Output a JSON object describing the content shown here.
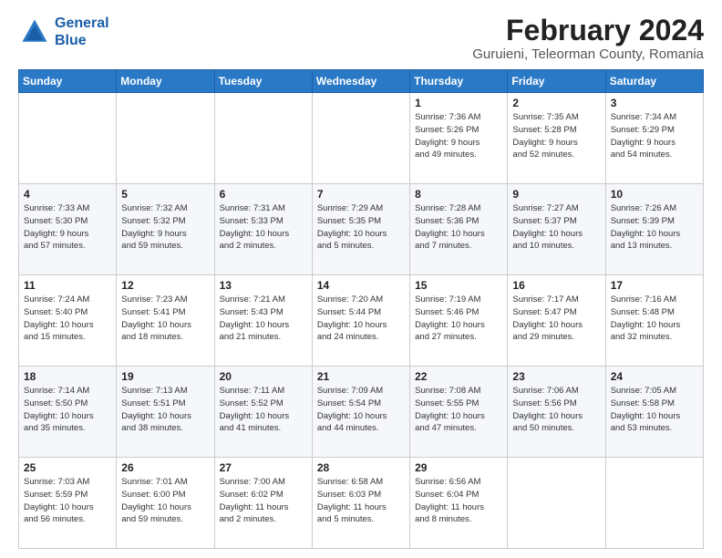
{
  "header": {
    "logo_line1": "General",
    "logo_line2": "Blue",
    "title": "February 2024",
    "subtitle": "Guruieni, Teleorman County, Romania"
  },
  "days_of_week": [
    "Sunday",
    "Monday",
    "Tuesday",
    "Wednesday",
    "Thursday",
    "Friday",
    "Saturday"
  ],
  "weeks": [
    [
      {
        "day": "",
        "info": ""
      },
      {
        "day": "",
        "info": ""
      },
      {
        "day": "",
        "info": ""
      },
      {
        "day": "",
        "info": ""
      },
      {
        "day": "1",
        "info": "Sunrise: 7:36 AM\nSunset: 5:26 PM\nDaylight: 9 hours\nand 49 minutes."
      },
      {
        "day": "2",
        "info": "Sunrise: 7:35 AM\nSunset: 5:28 PM\nDaylight: 9 hours\nand 52 minutes."
      },
      {
        "day": "3",
        "info": "Sunrise: 7:34 AM\nSunset: 5:29 PM\nDaylight: 9 hours\nand 54 minutes."
      }
    ],
    [
      {
        "day": "4",
        "info": "Sunrise: 7:33 AM\nSunset: 5:30 PM\nDaylight: 9 hours\nand 57 minutes."
      },
      {
        "day": "5",
        "info": "Sunrise: 7:32 AM\nSunset: 5:32 PM\nDaylight: 9 hours\nand 59 minutes."
      },
      {
        "day": "6",
        "info": "Sunrise: 7:31 AM\nSunset: 5:33 PM\nDaylight: 10 hours\nand 2 minutes."
      },
      {
        "day": "7",
        "info": "Sunrise: 7:29 AM\nSunset: 5:35 PM\nDaylight: 10 hours\nand 5 minutes."
      },
      {
        "day": "8",
        "info": "Sunrise: 7:28 AM\nSunset: 5:36 PM\nDaylight: 10 hours\nand 7 minutes."
      },
      {
        "day": "9",
        "info": "Sunrise: 7:27 AM\nSunset: 5:37 PM\nDaylight: 10 hours\nand 10 minutes."
      },
      {
        "day": "10",
        "info": "Sunrise: 7:26 AM\nSunset: 5:39 PM\nDaylight: 10 hours\nand 13 minutes."
      }
    ],
    [
      {
        "day": "11",
        "info": "Sunrise: 7:24 AM\nSunset: 5:40 PM\nDaylight: 10 hours\nand 15 minutes."
      },
      {
        "day": "12",
        "info": "Sunrise: 7:23 AM\nSunset: 5:41 PM\nDaylight: 10 hours\nand 18 minutes."
      },
      {
        "day": "13",
        "info": "Sunrise: 7:21 AM\nSunset: 5:43 PM\nDaylight: 10 hours\nand 21 minutes."
      },
      {
        "day": "14",
        "info": "Sunrise: 7:20 AM\nSunset: 5:44 PM\nDaylight: 10 hours\nand 24 minutes."
      },
      {
        "day": "15",
        "info": "Sunrise: 7:19 AM\nSunset: 5:46 PM\nDaylight: 10 hours\nand 27 minutes."
      },
      {
        "day": "16",
        "info": "Sunrise: 7:17 AM\nSunset: 5:47 PM\nDaylight: 10 hours\nand 29 minutes."
      },
      {
        "day": "17",
        "info": "Sunrise: 7:16 AM\nSunset: 5:48 PM\nDaylight: 10 hours\nand 32 minutes."
      }
    ],
    [
      {
        "day": "18",
        "info": "Sunrise: 7:14 AM\nSunset: 5:50 PM\nDaylight: 10 hours\nand 35 minutes."
      },
      {
        "day": "19",
        "info": "Sunrise: 7:13 AM\nSunset: 5:51 PM\nDaylight: 10 hours\nand 38 minutes."
      },
      {
        "day": "20",
        "info": "Sunrise: 7:11 AM\nSunset: 5:52 PM\nDaylight: 10 hours\nand 41 minutes."
      },
      {
        "day": "21",
        "info": "Sunrise: 7:09 AM\nSunset: 5:54 PM\nDaylight: 10 hours\nand 44 minutes."
      },
      {
        "day": "22",
        "info": "Sunrise: 7:08 AM\nSunset: 5:55 PM\nDaylight: 10 hours\nand 47 minutes."
      },
      {
        "day": "23",
        "info": "Sunrise: 7:06 AM\nSunset: 5:56 PM\nDaylight: 10 hours\nand 50 minutes."
      },
      {
        "day": "24",
        "info": "Sunrise: 7:05 AM\nSunset: 5:58 PM\nDaylight: 10 hours\nand 53 minutes."
      }
    ],
    [
      {
        "day": "25",
        "info": "Sunrise: 7:03 AM\nSunset: 5:59 PM\nDaylight: 10 hours\nand 56 minutes."
      },
      {
        "day": "26",
        "info": "Sunrise: 7:01 AM\nSunset: 6:00 PM\nDaylight: 10 hours\nand 59 minutes."
      },
      {
        "day": "27",
        "info": "Sunrise: 7:00 AM\nSunset: 6:02 PM\nDaylight: 11 hours\nand 2 minutes."
      },
      {
        "day": "28",
        "info": "Sunrise: 6:58 AM\nSunset: 6:03 PM\nDaylight: 11 hours\nand 5 minutes."
      },
      {
        "day": "29",
        "info": "Sunrise: 6:56 AM\nSunset: 6:04 PM\nDaylight: 11 hours\nand 8 minutes."
      },
      {
        "day": "",
        "info": ""
      },
      {
        "day": "",
        "info": ""
      }
    ]
  ]
}
